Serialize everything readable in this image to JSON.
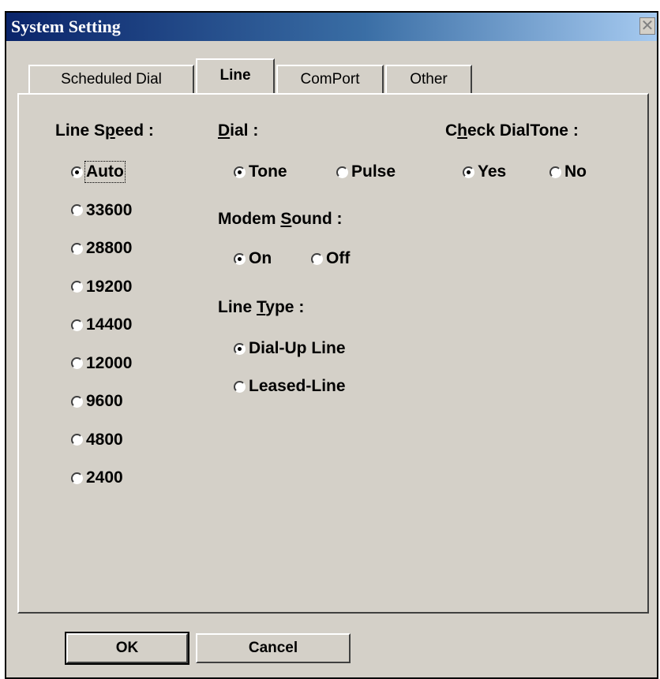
{
  "window": {
    "title": "System Setting",
    "close": "✕"
  },
  "tabs": [
    {
      "label": "Scheduled Dial"
    },
    {
      "label": "Line"
    },
    {
      "label": "ComPort"
    },
    {
      "label": "Other"
    }
  ],
  "line_speed": {
    "label_pre": "Line S",
    "label_key": "p",
    "label_post": "eed :",
    "options": [
      "Auto",
      "33600",
      "28800",
      "19200",
      "14400",
      "12000",
      "9600",
      "4800",
      "2400"
    ],
    "selected": "Auto"
  },
  "dial": {
    "label_key": "D",
    "label_post": "ial :",
    "options": [
      "Tone",
      "Pulse"
    ],
    "selected": "Tone"
  },
  "check_dialtone": {
    "label_pre": "C",
    "label_key": "h",
    "label_post": "eck DialTone :",
    "options": [
      "Yes",
      "No"
    ],
    "selected": "Yes"
  },
  "modem_sound": {
    "label_pre": "Modem ",
    "label_key": "S",
    "label_post": "ound :",
    "options": [
      "On",
      "Off"
    ],
    "selected": "On"
  },
  "line_type": {
    "label_pre": "Line ",
    "label_key": "T",
    "label_post": "ype :",
    "options": [
      "Dial-Up Line",
      "Leased-Line"
    ],
    "selected": "Dial-Up Line"
  },
  "buttons": {
    "ok": "OK",
    "cancel": "Cancel"
  }
}
